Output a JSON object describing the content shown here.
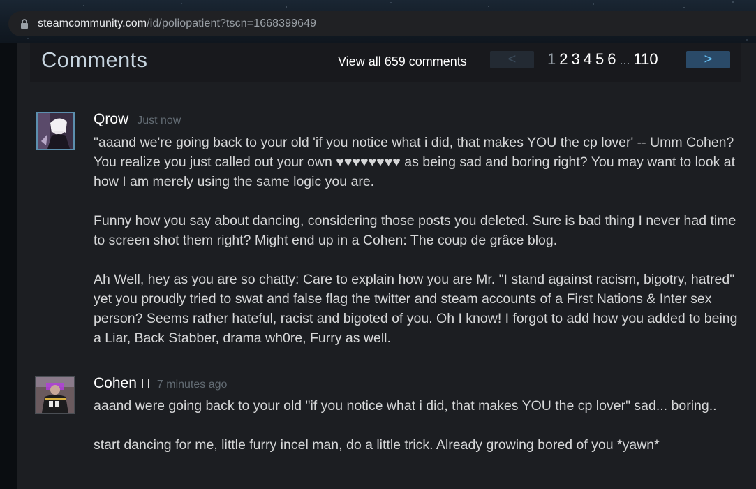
{
  "browser": {
    "url_host": "steamcommunity.com",
    "url_path": "/id/poliopatient?tscn=1668399649"
  },
  "comments_header": {
    "title": "Comments",
    "view_all": "View all 659 comments",
    "prev_label": "<",
    "next_label": ">",
    "pages": [
      "1",
      "2",
      "3",
      "4",
      "5",
      "6"
    ],
    "ellipsis": "...",
    "last_page": "110",
    "current_page": "1"
  },
  "comments": [
    {
      "author": "Qrow",
      "time": "Just now",
      "paragraphs": [
        "\"aaand we're going back to your old 'if you notice what i did, that makes YOU the cp lover' -- Umm Cohen? You realize you just called out your own ♥♥♥♥♥♥♥♥ as being sad and boring right? You may want to look at how I am merely using the same logic you are.",
        "Funny how you say about dancing, considering those posts you deleted. Sure is bad thing I never had time to screen shot them right? Might end up in a Cohen: The coup de grâce blog.",
        "Ah Well, hey as you are so chatty: Care to explain how you are Mr. \"I stand against racism, bigotry, hatred\" yet you proudly tried to swat and false flag the twitter and steam accounts of a First Nations & Inter sex person? Seems rather hateful, racist and bigoted of you. Oh I know! I forgot to add how you added to being a Liar, Back Stabber, drama wh0re, Furry as well."
      ]
    },
    {
      "author": "Cohen",
      "time": "7 minutes ago",
      "paragraphs": [
        "aaand were going back to your old \"if you notice what i did, that makes YOU the cp lover\" sad... boring..",
        "start dancing for me, little furry incel man, do a little trick. Already growing bored of you *yawn*"
      ]
    }
  ],
  "colors": {
    "accent_link": "#67c1f5",
    "text_primary": "#d6d7d8",
    "timestamp": "#626b73"
  }
}
